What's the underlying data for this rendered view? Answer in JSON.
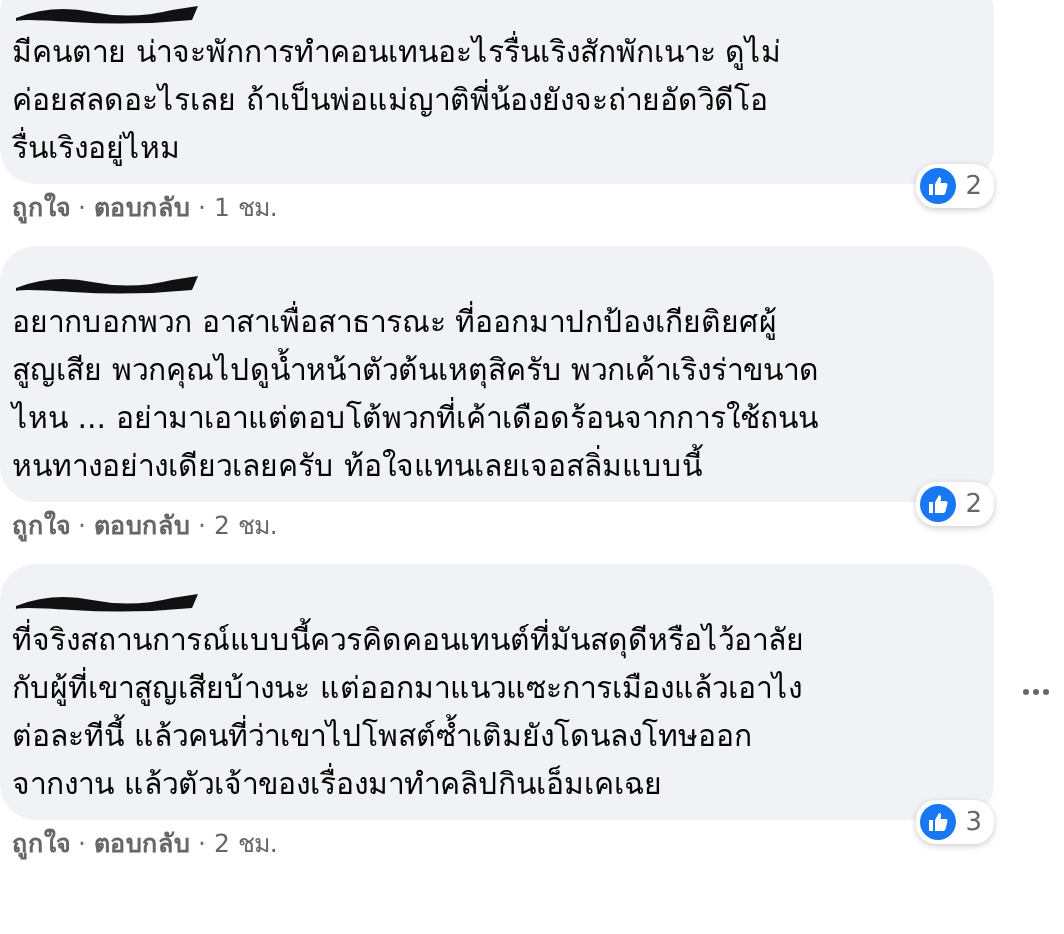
{
  "comments": [
    {
      "text": "มีคนตาย น่าจะพักการทำคอนเทนอะไรรื่นเริงสักพักเนาะ ดูไม่\nค่อยสลดอะไรเลย ถ้าเป็นพ่อแม่ญาติพี่น้องยังจะถ่ายอัดวิดีโอ\nรื่นเริงอยู่ไหม",
      "reactions": "2",
      "like": "ถูกใจ",
      "sep": "·",
      "reply": "ตอบกลับ",
      "sep2": "·",
      "time": "1 ชม.",
      "more": false
    },
    {
      "text": "อยากบอกพวก อาสาเพื่อสาธารณะ ที่ออกมาปกป้องเกียติยศผู้\nสูญเสีย พวกคุณไปดูน้ำหน้าตัวต้นเหตุสิครับ พวกเค้าเริงร่าขนาด\nไหน ... อย่ามาเอาแต่ตอบโต้พวกที่เค้าเดือดร้อนจากการใช้ถนน\nหนทางอย่างเดียวเลยครับ ท้อใจแทนเลยเจอสลิ่มแบบนี้",
      "reactions": "2",
      "like": "ถูกใจ",
      "sep": "·",
      "reply": "ตอบกลับ",
      "sep2": "·",
      "time": "2 ชม.",
      "more": false
    },
    {
      "text": "ที่จริงสถานการณ์แบบนี้ควรคิดคอนเทนต์ที่มันสดุดีหรือไว้อาลัย\nกับผู้ที่เขาสูญเสียบ้างนะ แต่ออกมาแนวแซะการเมืองแล้วเอาไง\nต่อละทีนี้ แล้วคนที่ว่าเขาไปโพสต์ซ้ำเติมยังโดนลงโทษออก\nจากงาน แล้วตัวเจ้าของเรื่องมาทำคลิปกินเอ็มเคเฉย",
      "reactions": "3",
      "like": "ถูกใจ",
      "sep": "·",
      "reply": "ตอบกลับ",
      "sep2": "·",
      "time": "2 ชม.",
      "more": true
    }
  ]
}
